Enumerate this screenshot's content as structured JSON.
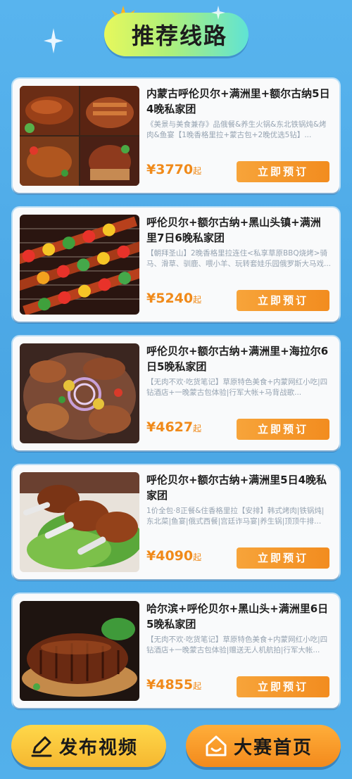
{
  "header": {
    "title": "推荐线路"
  },
  "cards": [
    {
      "title": "内蒙古呼伦贝尔+满洲里+额尔古纳5日4晚私家团",
      "desc": "《美景与美食兼存》品俄餐&养生火锅&东北铁锅炖&烤肉&鱼宴【1晚香格里拉+蒙古包+2晚优选5钻】...",
      "price": "¥3770",
      "price_unit": "起",
      "button": "立即预订",
      "image": "grilled-meat-collage"
    },
    {
      "title": "呼伦贝尔+额尔古纳+黑山头镇+满洲里7日6晚私家团",
      "desc": "【朝拜圣山】2晚香格里拉连住<私享草原BBQ烧烤>骑马、滑草、驯鹿、喂小羊、玩转套娃乐园俄罗斯大马戏...",
      "price": "¥5240",
      "price_unit": "起",
      "button": "立即预订",
      "image": "bbq-skewers"
    },
    {
      "title": "呼伦贝尔+额尔古纳+满洲里+海拉尔6日5晚私家团",
      "desc": "【无肉不欢·吃货笔记】草原特色美食+内蒙网红小吃|四钻酒店+一晚蒙古包体验|行军大帐+马背战歌...",
      "price": "¥4627",
      "price_unit": "起",
      "button": "立即预订",
      "image": "roast-meat-platter"
    },
    {
      "title": "呼伦贝尔+额尔古纳+满洲里5日4晚私家团",
      "desc": "1价全包·8正餐&住香格里拉【安排】韩式烤肉|铁锅炖|东北菜|鱼宴|俄式西餐|宫廷诈马宴|养生锅|顶顶牛排...",
      "price": "¥4090",
      "price_unit": "起",
      "button": "立即预订",
      "image": "roast-drumsticks"
    },
    {
      "title": "哈尔滨+呼伦贝尔+黑山头+满洲里6日5晚私家团",
      "desc": "【无肉不欢·吃货笔记】草原特色美食+内蒙网红小吃|四钻酒店+一晚蒙古包体验|赠送无人机航拍|行军大帐...",
      "price": "¥4855",
      "price_unit": "起",
      "button": "立即预订",
      "image": "roast-lamb-leg"
    }
  ],
  "footer": {
    "publish_label": "发布视频",
    "home_label": "大赛首页"
  }
}
